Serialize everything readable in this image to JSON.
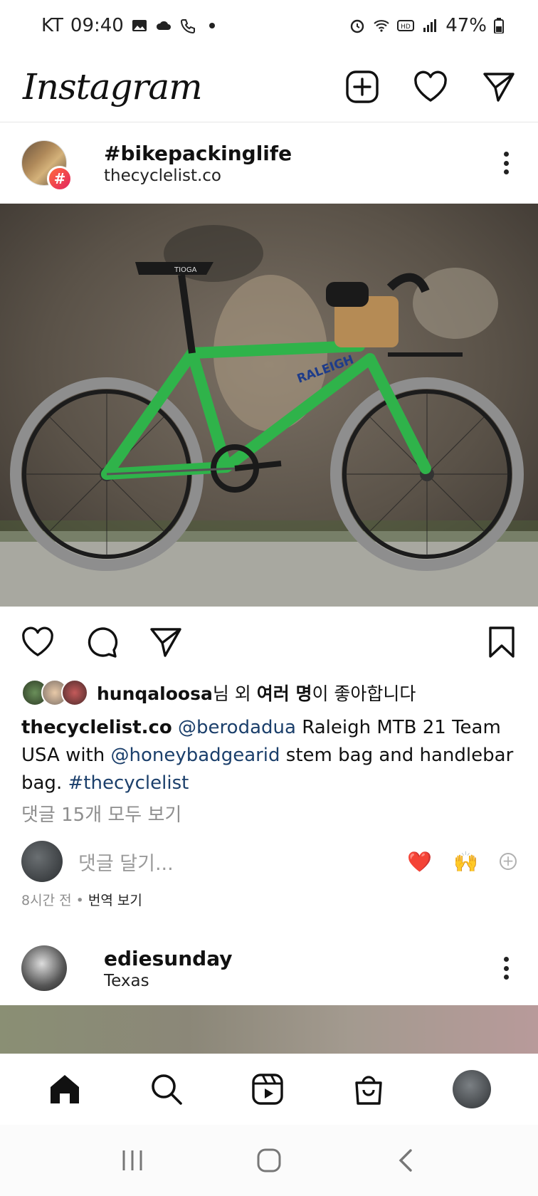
{
  "status_bar": {
    "carrier": "KT",
    "time": "09:40",
    "left_icons": [
      "gallery-icon",
      "cloud-icon",
      "wifi-call-icon",
      "dot-icon"
    ],
    "right_icons": [
      "alarm-icon",
      "wifi-icon",
      "hd-icon",
      "signal-icon"
    ],
    "battery": "47%"
  },
  "header": {
    "logo": "Instagram",
    "actions": [
      "new-post-icon",
      "activity-heart-icon",
      "direct-message-icon"
    ]
  },
  "post": {
    "title": "#bikepackinglife",
    "subtitle": "thecyclelist.co",
    "badge": "#",
    "likes": {
      "user": "hunqaloosa",
      "suffix_1": "님 외 ",
      "bold": "여러 명",
      "suffix_2": "이 좋아합니다"
    },
    "caption": {
      "user": "thecyclelist.co",
      "mention_1": "@berodadua",
      "text_1": " Raleigh MTB 21 Team USA with ",
      "mention_2": "@honeybadgearid",
      "text_2": " stem bag and handlebar bag. ",
      "hashtag": "#thecyclelist"
    },
    "view_comments": "댓글 15개 모두 보기",
    "comment_placeholder": "댓글 달기...",
    "reactions": [
      "❤️",
      "🙌"
    ],
    "time_ago": "8시간 전",
    "translate": "번역 보기",
    "image_frame_text": "RALEIGH"
  },
  "post2": {
    "user": "ediesunday",
    "location": "Texas"
  },
  "bottom_nav": [
    "home-icon",
    "search-icon",
    "reels-icon",
    "shop-icon",
    "profile-avatar"
  ],
  "system_nav": [
    "recent-apps-icon",
    "home-button-icon",
    "back-icon"
  ]
}
